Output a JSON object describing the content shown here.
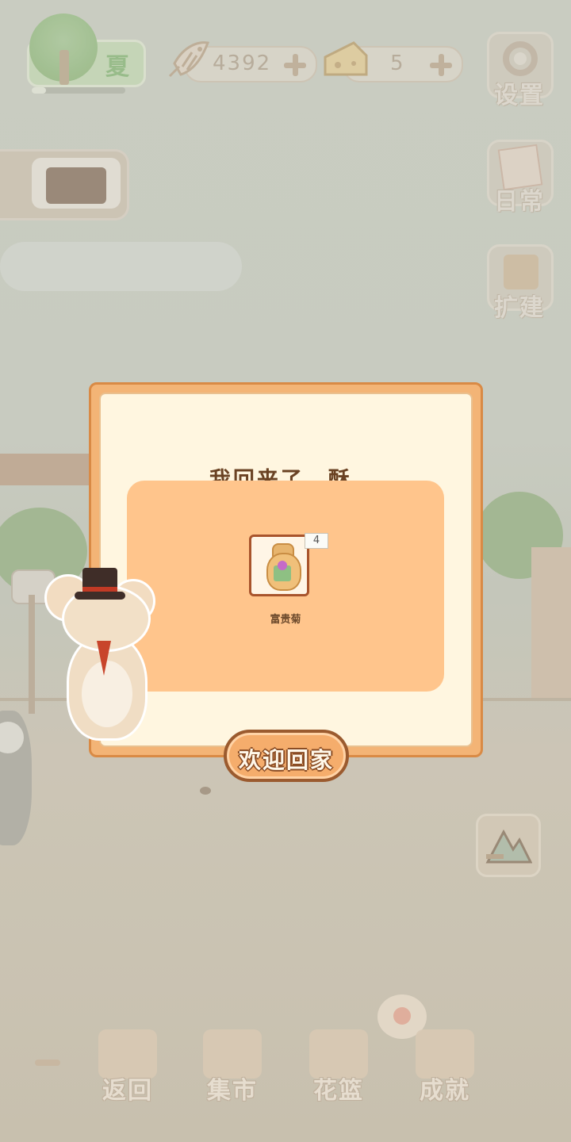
{
  "hud": {
    "season_label": "夏",
    "season_progress": 0.15,
    "fish_count": "4392",
    "cheese_count": "5"
  },
  "side_menu": {
    "settings_label": "设置",
    "daily_label": "日常",
    "expand_label": "扩建"
  },
  "dialog": {
    "title": "我回来了，酥.",
    "reward": {
      "item_name": "富贵菊",
      "quantity": "4"
    },
    "confirm_label": "欢迎回家"
  },
  "bottom_nav": {
    "items": [
      {
        "label": "返回"
      },
      {
        "label": "集市"
      },
      {
        "label": "花篮"
      },
      {
        "label": "成就"
      }
    ]
  },
  "colors": {
    "dialog_border": "#d98a45",
    "dialog_bg": "#fff6e0",
    "reward_panel": "#ffc58c",
    "button_fill": "#f5ad6c",
    "title_text": "#6a4223"
  }
}
